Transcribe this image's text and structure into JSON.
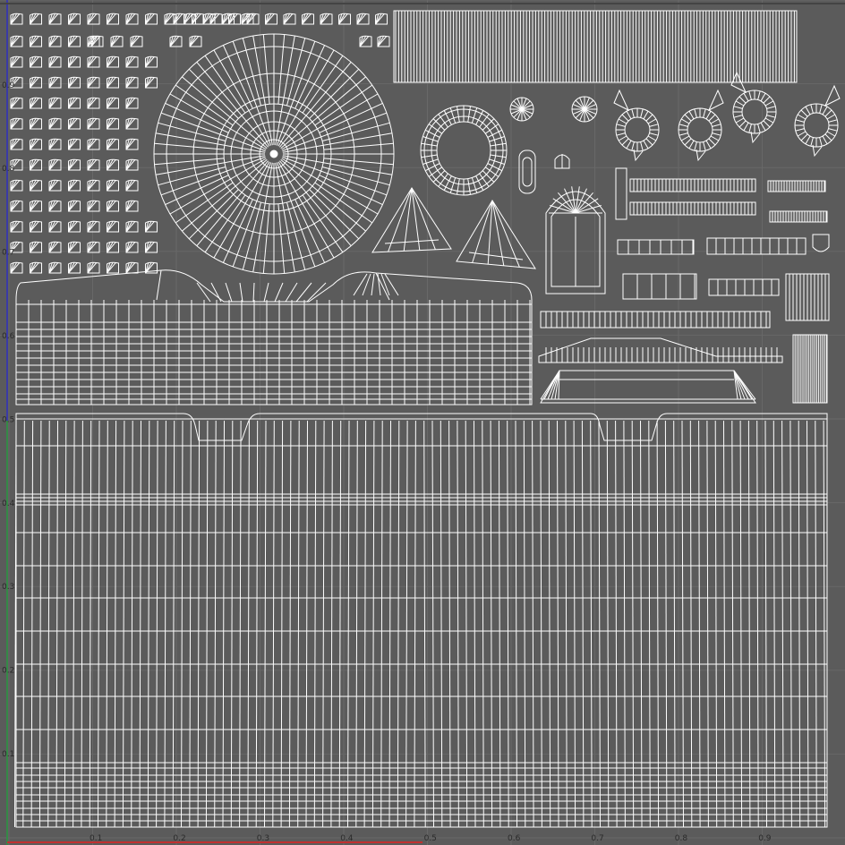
{
  "editor": {
    "view": "UV Editor"
  },
  "axes": {
    "u_labels": [
      "0.1",
      "0.2",
      "0.3",
      "0.4",
      "0.5",
      "0.6",
      "0.7",
      "0.8",
      "0.9"
    ],
    "v_labels": [
      "0.1",
      "0.2",
      "0.3",
      "0.4",
      "0.5",
      "0.6",
      "0.7",
      "0.8",
      "0.9"
    ]
  },
  "colors": {
    "background": "#5b5b5b",
    "grid": "#686868",
    "wire": "#ffffff",
    "axis_label": "#2a2a2a",
    "u_axis": "#c03030",
    "v_axis": "#30a030",
    "border_left": "#3030c0"
  }
}
